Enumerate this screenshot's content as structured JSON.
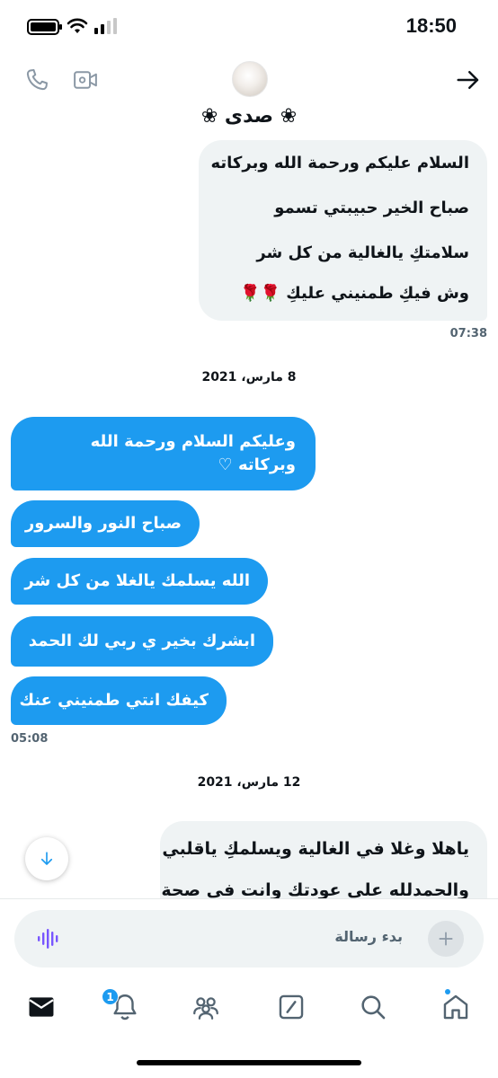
{
  "status_bar": {
    "time": "18:50"
  },
  "header": {
    "title": "❀ صدى ❀"
  },
  "messages": {
    "incoming_1": {
      "lines": [
        "السلام عليكم ورحمة الله وبركاته",
        "صباح الخير حبيبتي تسمو",
        "سلامتكِ يالغالية من كل شر",
        "وش فيكِ طمنيني عليكِ 🌹🌹"
      ],
      "time": "07:38"
    },
    "date_1": "8 مارس، 2021",
    "outgoing": [
      {
        "text": "وعليكم السلام ورحمة الله وبركاته ♡"
      },
      {
        "text": "صباح النور والسرور"
      },
      {
        "text": "الله يسلمك يالغلا من كل شر"
      },
      {
        "text": "ابشرك بخير ي ربي لك الحمد"
      },
      {
        "text": "كيفك انتي طمنيني عنك"
      }
    ],
    "outgoing_time": "05:08",
    "date_2": "12 مارس، 2021",
    "incoming_2": {
      "lines": [
        "ياهلا وغلا في الغالية ويسلمكِ ياقلبي",
        "والحمدلله على عودتك وانت في صحة"
      ]
    }
  },
  "composer": {
    "placeholder": "بدء رسالة"
  },
  "tabbar": {
    "notifications_badge": "1"
  },
  "colors": {
    "accent": "#1d9bf0",
    "incoming_bubble": "#eff3f4",
    "voice": "#7856ff"
  },
  "icons": [
    "phone-icon",
    "video-icon",
    "arrow-right-icon",
    "arrow-down-icon",
    "plus-icon",
    "voice-icon",
    "mail-icon",
    "bell-icon",
    "communities-icon",
    "compose-icon",
    "search-icon",
    "home-icon"
  ]
}
